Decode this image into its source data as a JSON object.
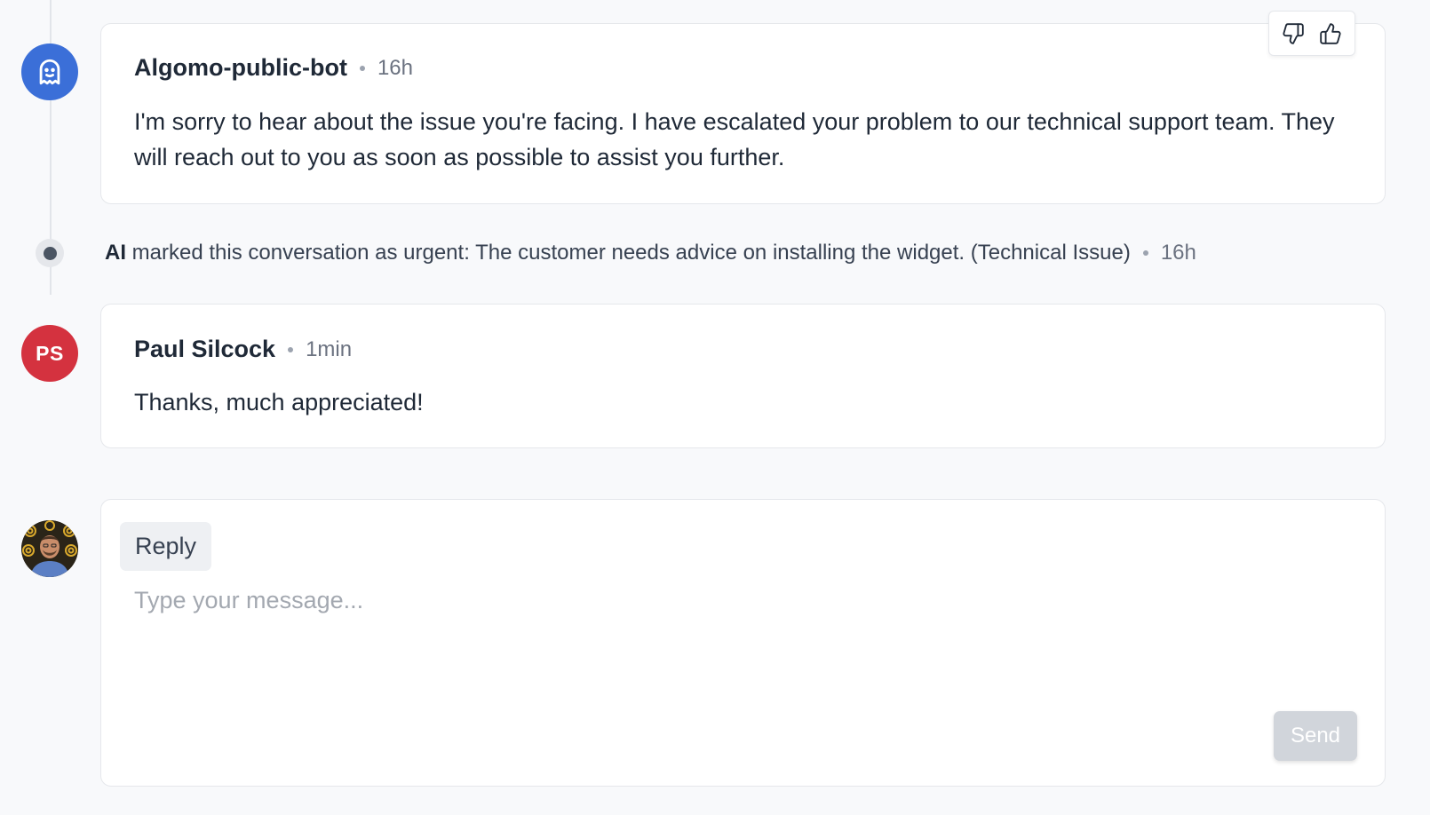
{
  "messages": [
    {
      "author": "Algomo-public-bot",
      "time": "16h",
      "body": "I'm sorry to hear about the issue you're facing. I have escalated your problem to our technical support team. They will reach out to you as soon as possible to assist you further.",
      "avatar_icon": "ghost-icon"
    },
    {
      "author": "Paul Silcock",
      "time": "1min",
      "body": "Thanks, much appreciated!",
      "avatar_initials": "PS"
    }
  ],
  "event": {
    "actor": "AI",
    "text": "marked this conversation as urgent: The customer needs advice on installing the widget. (Technical Issue)",
    "time": "16h"
  },
  "feedback": {
    "thumbs_down_icon": "thumbs-down-icon",
    "thumbs_up_icon": "thumbs-up-icon"
  },
  "reply": {
    "tab_label": "Reply",
    "placeholder": "Type your message...",
    "value": "",
    "send_label": "Send"
  },
  "colors": {
    "bot_avatar": "#3b6fd8",
    "ps_avatar": "#d4323f",
    "send_disabled": "#d1d5db",
    "background": "#f8f9fb"
  }
}
